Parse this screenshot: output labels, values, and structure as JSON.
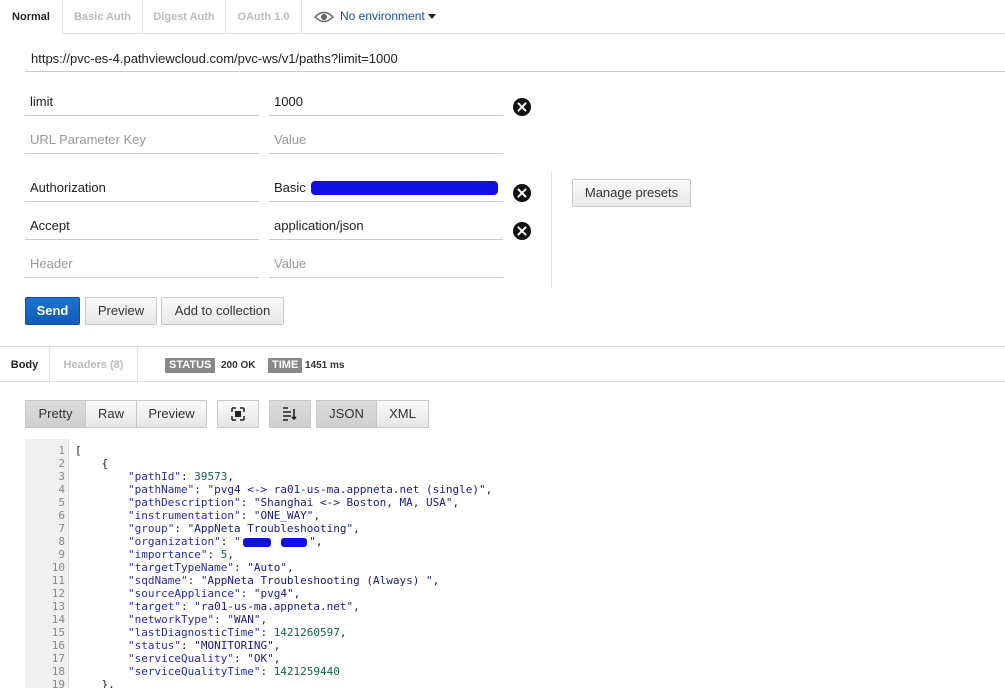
{
  "auth_tabs": [
    "Normal",
    "Basic Auth",
    "Digest Auth",
    "OAuth 1.0"
  ],
  "environment": {
    "label": "No environment",
    "icon": "eye-icon"
  },
  "request": {
    "url": "https://pvc-es-4.pathviewcloud.com/pvc-ws/v1/paths?limit=1000",
    "params": [
      {
        "key": "limit",
        "value": "1000"
      }
    ],
    "param_key_placeholder": "URL Parameter Key",
    "param_value_placeholder": "Value",
    "headers": [
      {
        "key": "Authorization",
        "value": "Basic"
      },
      {
        "key": "Accept",
        "value": "application/json"
      }
    ],
    "header_key_placeholder": "Header",
    "header_value_placeholder": "Value",
    "manage_presets_label": "Manage presets"
  },
  "actions": {
    "send": "Send",
    "preview": "Preview",
    "add_to_collection": "Add to collection"
  },
  "response": {
    "tabs": [
      "Body",
      "Headers (8)"
    ],
    "status_label": "STATUS",
    "status_value": "200 OK",
    "time_label": "TIME",
    "time_value": "1451 ms",
    "view_modes": [
      "Pretty",
      "Raw",
      "Preview"
    ],
    "formats": [
      "JSON",
      "XML"
    ],
    "icons": [
      "fullscreen-icon",
      "wrap-lines-icon"
    ]
  },
  "body_lines": [
    {
      "n": "1",
      "text": "["
    },
    {
      "n": "2",
      "text": "    {"
    },
    {
      "n": "3",
      "key": "pathId",
      "value": "39573",
      "type": "num"
    },
    {
      "n": "4",
      "key": "pathName",
      "value": "pvg4 <-> ra01-us-ma.appneta.net (single)",
      "type": "str"
    },
    {
      "n": "5",
      "key": "pathDescription",
      "value": "Shanghai <-> Boston, MA, USA",
      "type": "str"
    },
    {
      "n": "6",
      "key": "instrumentation",
      "value": "ONE_WAY",
      "type": "str"
    },
    {
      "n": "7",
      "key": "group",
      "value": "AppNeta Troubleshooting",
      "type": "str"
    },
    {
      "n": "8",
      "key": "organization",
      "value": "",
      "type": "redacted"
    },
    {
      "n": "9",
      "key": "importance",
      "value": "5",
      "type": "num"
    },
    {
      "n": "10",
      "key": "targetTypeName",
      "value": "Auto",
      "type": "str"
    },
    {
      "n": "11",
      "key": "sqdName",
      "value": "AppNeta Troubleshooting (Always) ",
      "type": "str"
    },
    {
      "n": "12",
      "key": "sourceAppliance",
      "value": "pvg4",
      "type": "str"
    },
    {
      "n": "13",
      "key": "target",
      "value": "ra01-us-ma.appneta.net",
      "type": "str"
    },
    {
      "n": "14",
      "key": "networkType",
      "value": "WAN",
      "type": "str"
    },
    {
      "n": "15",
      "key": "lastDiagnosticTime",
      "value": "1421260597",
      "type": "num"
    },
    {
      "n": "16",
      "key": "status",
      "value": "MONITORING",
      "type": "str"
    },
    {
      "n": "17",
      "key": "serviceQuality",
      "value": "OK",
      "type": "str"
    },
    {
      "n": "18",
      "key": "serviceQualityTime",
      "value": "1421259440",
      "type": "num",
      "last": true
    },
    {
      "n": "19",
      "text": "    },"
    }
  ]
}
